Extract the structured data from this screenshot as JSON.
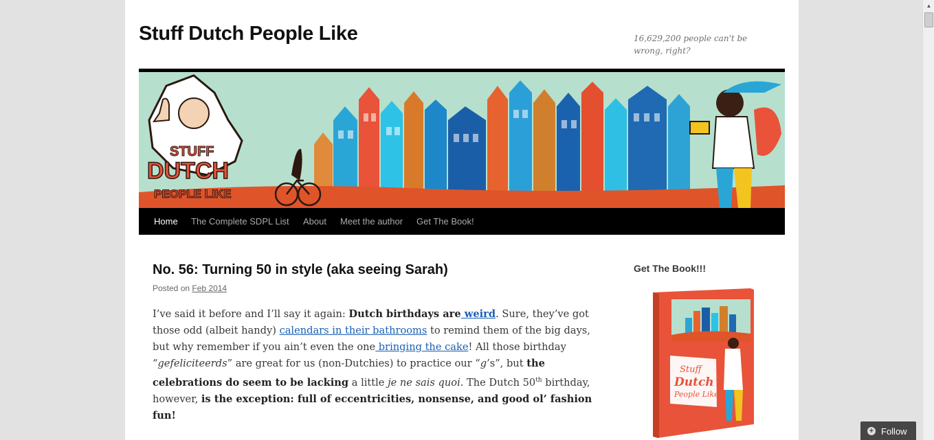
{
  "site": {
    "title": "Stuff Dutch People Like",
    "description": "16,629,200 people can't be wrong, right?"
  },
  "banner": {
    "logo_lines": [
      "STUFF",
      "DUTCH",
      "PEOPLE LIKE"
    ]
  },
  "nav": {
    "items": [
      {
        "label": "Home",
        "current": true
      },
      {
        "label": "The Complete SDPL List",
        "current": false
      },
      {
        "label": "About",
        "current": false
      },
      {
        "label": "Meet the author",
        "current": false
      },
      {
        "label": "Get The Book!",
        "current": false
      }
    ]
  },
  "post": {
    "title": "No. 56: Turning 50 in style (aka seeing Sarah)",
    "meta_prefix": "Posted on",
    "meta_date": "Feb 2014",
    "p1": {
      "t1": "I’ve said it before and I’ll say it again: ",
      "b1": "Dutch birthdays are",
      "link_weird": " weird",
      "t2": ". Sure, they’ve got those odd (albeit handy) ",
      "link_calendars": "calendars in their bathrooms",
      "t3": " to remind them of the big days, but why remember if you ain’t even the one",
      "link_cake": " bringing the cake",
      "t4": "! All those birthday “",
      "i1": "gefeliciteerds",
      "t5": "” are great for us (non-Dutchies) to practice our “",
      "i2": "g",
      "t6": "’s”, but ",
      "b2": "the celebrations do seem to be lacking",
      "t7": " a little ",
      "i3": "je ne sais quoi",
      "t8": ". The Dutch 50",
      "sup": "th",
      "t9": " birthday, however, ",
      "b3": "is the exception: full of eccentricities, nonsense, and good ol’ fashion fun!"
    }
  },
  "sidebar": {
    "widget_title": "Get The Book!!!",
    "book_cover_lines": [
      "Stuff",
      "Dutch",
      "People Like"
    ]
  },
  "follow": {
    "label": "Follow"
  },
  "colors": {
    "nav_bg": "#000000",
    "link": "#1a5fb4",
    "banner_sky": "#b6e0cd",
    "banner_ground": "#e0542a"
  }
}
